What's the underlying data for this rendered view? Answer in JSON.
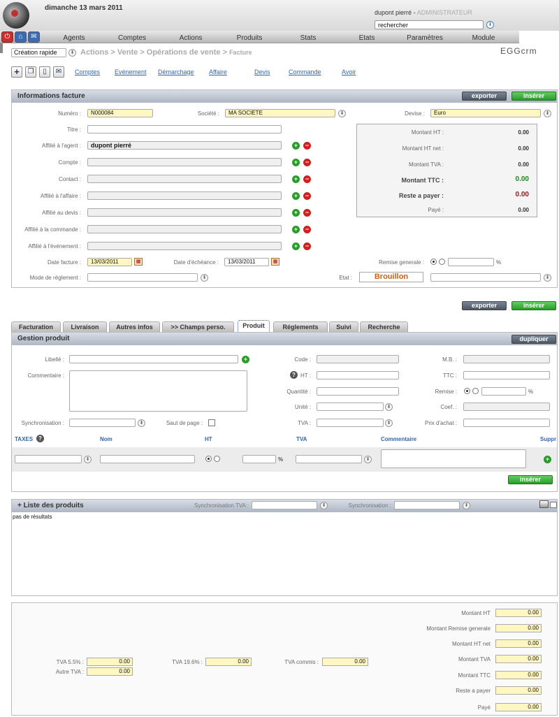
{
  "header": {
    "date": "dimanche 13 mars 2011",
    "user_name": "dupont pierré",
    "user_separator": "-",
    "user_role": "ADMINISTRATEUR",
    "search_value": "rechercher"
  },
  "nav": {
    "items": [
      "Agents",
      "Comptes",
      "Actions",
      "Produits",
      "Stats",
      "Etats",
      "Paramètres",
      "Module"
    ]
  },
  "breadcrumb": {
    "quick_create": "Création rapide",
    "path": "Actions > Vente > Opérations de vente >",
    "last": "Facture",
    "brand": "EGGcrm"
  },
  "links": [
    "Comptes",
    "Evénement",
    "Démarchage",
    "Affaire",
    "Devis",
    "Commande",
    "Avoir"
  ],
  "invoice": {
    "title": "Informations facture",
    "export_label": "exporter",
    "insert_label": "insérer",
    "labels": {
      "numero": "Numéro :",
      "societe": "Société :",
      "devise": "Devise :",
      "titre": "Titre :",
      "agent": "Affilié à l'agent :",
      "compte": "Compte :",
      "contact": "Contact :",
      "affaire": "Affilié à l'affaire :",
      "devis": "Affilié au devis :",
      "commande": "Affilié à la commande :",
      "evenement": "Affilié à l'événement :",
      "date_facture": "Date facture :",
      "date_echeance": "Date d'échéance :",
      "remise_generale": "Remise generale :",
      "mode_reglement": "Mode de réglement :",
      "etat": "Etat :"
    },
    "values": {
      "numero": "N000084",
      "societe": "MA SOCIETE",
      "devise": "Euro",
      "agent": "dupont pierré",
      "date_facture": "13/03/2011",
      "date_echeance": "13/03/2011",
      "etat": "Brouillon",
      "percent": "%"
    },
    "totals": [
      {
        "label": "Montant HT :",
        "value": "0.00"
      },
      {
        "label": "Montant HT net :",
        "value": "0.00"
      },
      {
        "label": "Montant TVA :",
        "value": "0.00"
      },
      {
        "label": "Montant TTC :",
        "value": "0.00"
      },
      {
        "label": "Reste a payer :",
        "value": "0.00"
      },
      {
        "label": "Payé :",
        "value": "0.00"
      }
    ]
  },
  "tabs": [
    "Facturation",
    "Livraison",
    "Autres infos",
    ">> Champs perso.",
    "Produit",
    "Réglements",
    "Suivi",
    "Recherche"
  ],
  "product": {
    "title": "Gestion produit",
    "duplicate_label": "dupliquer",
    "insert_label": "insérer",
    "labels": {
      "libelle": "Libellé :",
      "commentaire": "Commentaire :",
      "synchronisation": "Synchronisation :",
      "saut_de_page": "Saut de page :",
      "code": "Code :",
      "ht": "HT :",
      "quantite": "Quantité :",
      "unite": "Unité :",
      "tva": "TVA :",
      "mb": "M.B. :",
      "ttc": "TTC :",
      "remise": "Remise :",
      "coef": "Coef. :",
      "prix_achat": "Prix d'achat :"
    },
    "percent": "%",
    "taxes_headers": [
      "TAXES",
      "Nom",
      "HT",
      "TVA",
      "Commentaire",
      "Suppr"
    ]
  },
  "product_list": {
    "title": "+ Liste des produits",
    "sync_tva_label": "Synchronisation TVA :",
    "sync_label": "Synchronisation :",
    "empty_text": "pas de résultats"
  },
  "summary": {
    "right": [
      {
        "label": "Montant HT",
        "value": "0.00"
      },
      {
        "label": "Montant Remise generale",
        "value": "0.00"
      },
      {
        "label": "Montant HT net",
        "value": "0.00"
      },
      {
        "label": "Montant TVA",
        "value": "0.00"
      },
      {
        "label": "Montant TTC",
        "value": "0.00"
      },
      {
        "label": "Reste a payer",
        "value": "0.00"
      },
      {
        "label": "Payé",
        "value": "0.00"
      }
    ],
    "tva55_label": "TVA 5.5% :",
    "tva55_value": "0.00",
    "autre_tva_label": "Autre TVA :",
    "autre_tva_value": "0.00",
    "tva196_label": "TVA 19.6% :",
    "tva196_value": "0.00",
    "tva_commis_label": "TVA commis :",
    "tva_commis_value": "0.00"
  }
}
